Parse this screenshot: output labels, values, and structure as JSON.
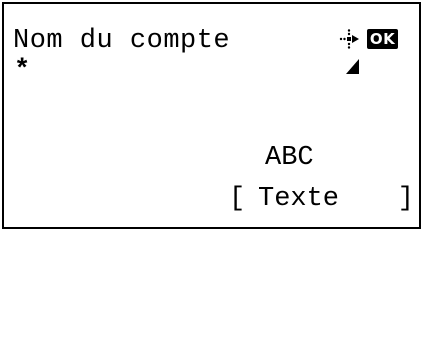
{
  "screen": {
    "title": "Nom du compte",
    "input_value": "*",
    "ok_label": "OK",
    "mode_label": "ABC",
    "softkey": {
      "bracket_left": "[",
      "label": "Texte",
      "bracket_right": "]"
    }
  },
  "icons": {
    "navigation": "four-way-nav-icon",
    "ok": "ok-key-icon",
    "cursor": "text-cursor-icon"
  },
  "colors": {
    "foreground": "#000000",
    "background": "#ffffff"
  }
}
